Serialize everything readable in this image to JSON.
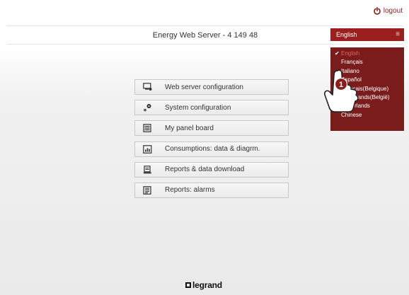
{
  "header": {
    "logout_label": "logout",
    "title": "Energy Web Server - 4 149 48"
  },
  "language_select": {
    "selected": "English",
    "menu_icon": "menu-icon",
    "options": [
      {
        "label": "English",
        "selected": true
      },
      {
        "label": "Français"
      },
      {
        "label": "Italiano"
      },
      {
        "label": "Español"
      },
      {
        "label": "Français(Belgique)"
      },
      {
        "label": "Nederlands(België)"
      },
      {
        "label": "Nederlands"
      },
      {
        "label": "Chinese"
      }
    ]
  },
  "menu": {
    "items": [
      {
        "label": "Web server configuration",
        "icon": "monitor-settings-icon"
      },
      {
        "label": "System configuration",
        "icon": "gears-icon"
      },
      {
        "label": "My panel board",
        "icon": "panel-board-icon"
      },
      {
        "label": "Consumptions: data & diagrm.",
        "icon": "bar-chart-icon"
      },
      {
        "label": "Reports & data download",
        "icon": "report-download-icon"
      },
      {
        "label": "Reports: alarms",
        "icon": "alarm-report-icon"
      }
    ]
  },
  "annotation": {
    "step_number": "1",
    "icon": "pointing-hand-icon"
  },
  "footer": {
    "logo_text": "legrand"
  },
  "colors": {
    "accent": "#9c1f1f",
    "dropdown_bg": "#7a1c1c",
    "selected_text": "#e26060"
  }
}
